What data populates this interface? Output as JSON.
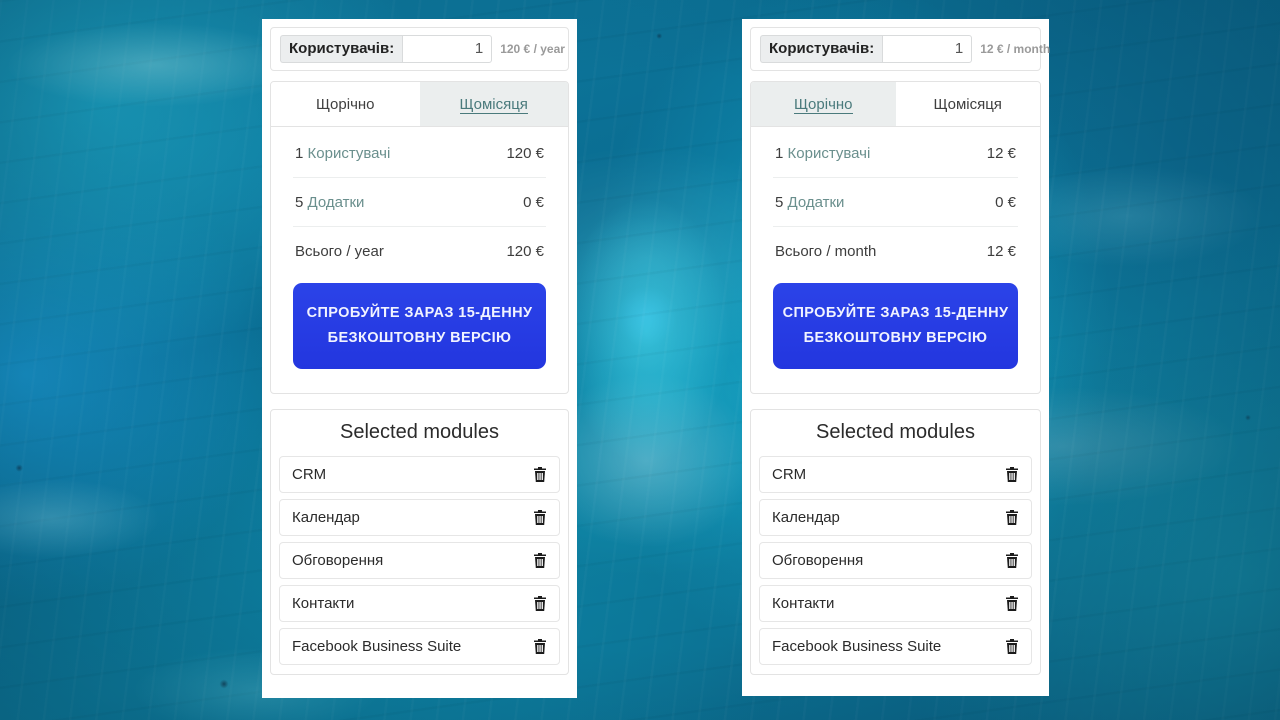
{
  "page": {
    "background_accent": "#0d7c9d",
    "panel_background": "#ffffff"
  },
  "panels": [
    {
      "id": "annual-plan-panel",
      "users": {
        "label": "Користувачів:",
        "value": "1",
        "placeholder": "1",
        "rate": "120 € / year"
      },
      "tabs": [
        {
          "label": "Щорічно",
          "state": "active"
        },
        {
          "label": "Щомісяця",
          "state": "inactive"
        }
      ],
      "rows": [
        {
          "count": "1",
          "name": "Користувачі",
          "amount": "120 €"
        },
        {
          "count": "5",
          "name": "Додатки",
          "amount": "0 €"
        }
      ],
      "total": {
        "label": "Всього / year",
        "amount": "120 €"
      },
      "cta": "СПРОБУЙТЕ ЗАРАЗ 15-ДЕННУ БЕЗКОШТОВНУ ВЕРСІЮ",
      "modules": {
        "title": "Selected modules",
        "items": [
          "CRM",
          "Календар",
          "Обговорення",
          "Контакти",
          "Facebook Business Suite"
        ],
        "delete_icon": "trash-icon"
      }
    },
    {
      "id": "monthly-plan-panel",
      "users": {
        "label": "Користувачів:",
        "value": "1",
        "placeholder": "1",
        "rate": "12 € / month"
      },
      "tabs": [
        {
          "label": "Щорічно",
          "state": "inactive"
        },
        {
          "label": "Щомісяця",
          "state": "active"
        }
      ],
      "rows": [
        {
          "count": "1",
          "name": "Користувачі",
          "amount": "12 €"
        },
        {
          "count": "5",
          "name": "Додатки",
          "amount": "0 €"
        }
      ],
      "total": {
        "label": "Всього / month",
        "amount": "12 €"
      },
      "cta": "СПРОБУЙТЕ ЗАРАЗ 15-ДЕННУ БЕЗКОШТОВНУ ВЕРСІЮ",
      "modules": {
        "title": "Selected modules",
        "items": [
          "CRM",
          "Календар",
          "Обговорення",
          "Контакти",
          "Facebook Business Suite"
        ],
        "delete_icon": "trash-icon"
      }
    }
  ]
}
